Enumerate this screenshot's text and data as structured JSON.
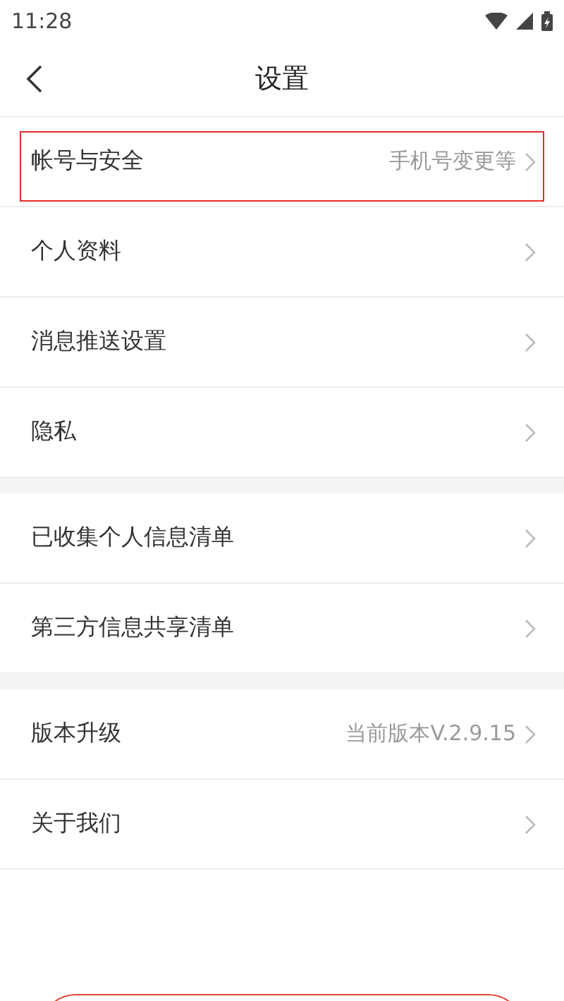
{
  "status_bar": {
    "time": "11:28"
  },
  "header": {
    "title": "设置"
  },
  "sections": [
    {
      "items": [
        {
          "label": "帐号与安全",
          "value": "手机号变更等",
          "highlighted": true
        },
        {
          "label": "个人资料",
          "highlighted": false
        },
        {
          "label": "消息推送设置",
          "highlighted": false
        },
        {
          "label": "隐私",
          "highlighted": false
        }
      ]
    },
    {
      "items": [
        {
          "label": "已收集个人信息清单",
          "highlighted": false
        },
        {
          "label": "第三方信息共享清单",
          "highlighted": false
        }
      ]
    },
    {
      "items": [
        {
          "label": "版本升级",
          "value": "当前版本V.2.9.15",
          "highlighted": false
        },
        {
          "label": "关于我们",
          "highlighted": false
        }
      ]
    }
  ],
  "bottom_button": {
    "kind": "outline"
  }
}
